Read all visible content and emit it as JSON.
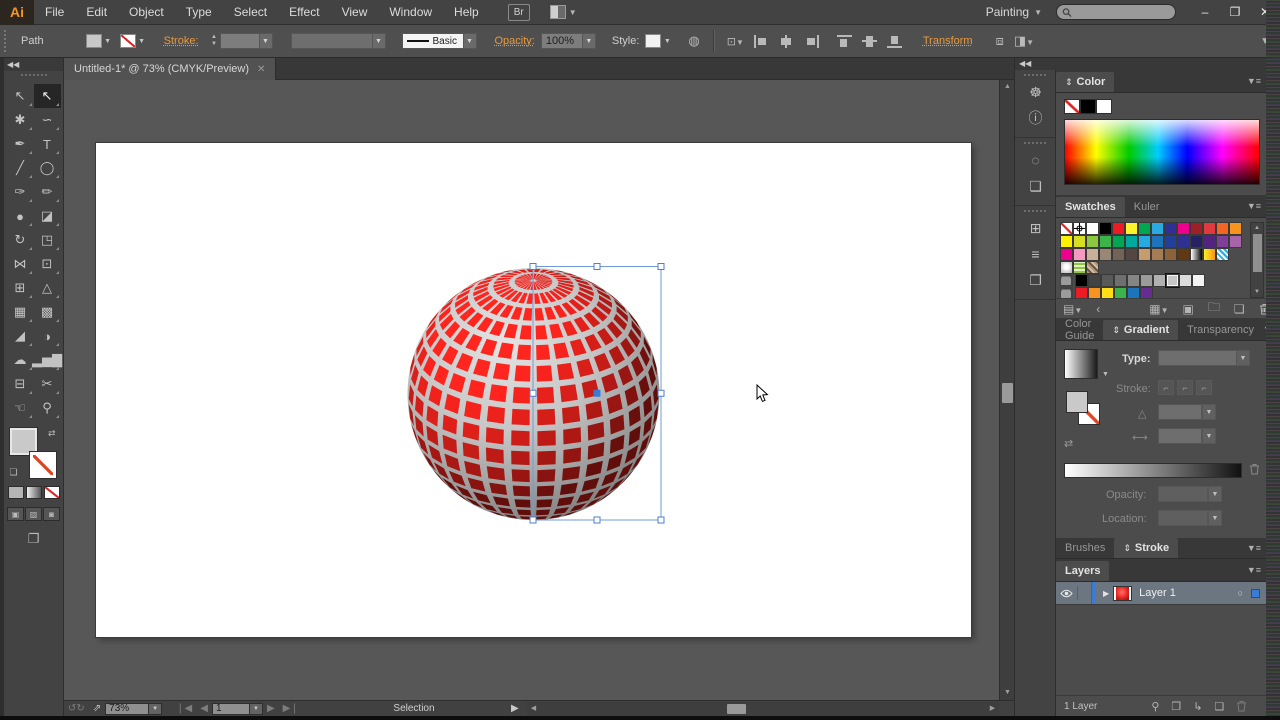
{
  "app": {
    "logo": "Ai",
    "menu_items": [
      "File",
      "Edit",
      "Object",
      "Type",
      "Select",
      "Effect",
      "View",
      "Window",
      "Help"
    ],
    "br_button": "Br",
    "workspace": "Painting",
    "search_placeholder": "",
    "window_icons": {
      "minimize": "–",
      "restore": "❐",
      "close": "✕"
    }
  },
  "control_bar": {
    "selection_type": "Path",
    "stroke_label": "Stroke:",
    "line_style": "Basic",
    "opacity_label": "Opacity:",
    "opacity_value": "100%",
    "style_label": "Style:",
    "transform_label": "Transform"
  },
  "document": {
    "tab_title": "Untitled-1* @ 73% (CMYK/Preview)",
    "close_glyph": "✕"
  },
  "status_bar": {
    "zoom_value": "73%",
    "artboard_value": "1",
    "status_text": "Selection",
    "nav_first": "❘◀",
    "nav_prev": "◀",
    "nav_next": "▶",
    "nav_last": "▶❘"
  },
  "toolbar": {
    "collapse_glyph": "◀◀",
    "tools": [
      {
        "name": "selection-tool",
        "glyph": "↖"
      },
      {
        "name": "direct-selection-tool",
        "glyph": "↖",
        "selected": true
      },
      {
        "name": "magic-wand-tool",
        "glyph": "✱"
      },
      {
        "name": "lasso-tool",
        "glyph": "∽"
      },
      {
        "name": "pen-tool",
        "glyph": "✒"
      },
      {
        "name": "type-tool",
        "glyph": "T"
      },
      {
        "name": "line-segment-tool",
        "glyph": "╱"
      },
      {
        "name": "ellipse-tool",
        "glyph": "◯"
      },
      {
        "name": "paintbrush-tool",
        "glyph": "✑"
      },
      {
        "name": "pencil-tool",
        "glyph": "✏"
      },
      {
        "name": "blob-brush-tool",
        "glyph": "●"
      },
      {
        "name": "eraser-tool",
        "glyph": "◪"
      },
      {
        "name": "rotate-tool",
        "glyph": "↻"
      },
      {
        "name": "scale-tool",
        "glyph": "◳"
      },
      {
        "name": "width-tool",
        "glyph": "⋈"
      },
      {
        "name": "free-transform-tool",
        "glyph": "⊡"
      },
      {
        "name": "shape-builder-tool",
        "glyph": "⊞"
      },
      {
        "name": "perspective-grid-tool",
        "glyph": "△"
      },
      {
        "name": "mesh-tool",
        "glyph": "▦"
      },
      {
        "name": "gradient-tool",
        "glyph": "▩"
      },
      {
        "name": "eyedropper-tool",
        "glyph": "◢"
      },
      {
        "name": "blend-tool",
        "glyph": "◑"
      },
      {
        "name": "symbol-sprayer-tool",
        "glyph": "☁"
      },
      {
        "name": "column-graph-tool",
        "glyph": "▂▅▇"
      },
      {
        "name": "artboard-tool",
        "glyph": "⊟"
      },
      {
        "name": "slice-tool",
        "glyph": "✂"
      },
      {
        "name": "hand-tool",
        "glyph": "☜"
      },
      {
        "name": "zoom-tool",
        "glyph": "⚲"
      }
    ]
  },
  "dock": {
    "collapse_glyph": "◀◀",
    "icon_sections": [
      [
        {
          "name": "navigator-icon",
          "glyph": "☸"
        },
        {
          "name": "info-icon",
          "glyph": "ⓘ"
        }
      ],
      [
        {
          "name": "attributes-icon",
          "glyph": "◌"
        },
        {
          "name": "document-info-icon",
          "glyph": "❏"
        }
      ],
      [
        {
          "name": "artboards-icon",
          "glyph": "⊞"
        },
        {
          "name": "align-icon",
          "glyph": "≡"
        },
        {
          "name": "pathfinder-icon",
          "glyph": "❐"
        }
      ]
    ]
  },
  "panels": {
    "color": {
      "title": "Color"
    },
    "swatches": {
      "tabs": [
        "Swatches",
        "Kuler"
      ],
      "rows": [
        [
          "none",
          "reg",
          "#ffffff",
          "#000000",
          "#ed1b24",
          "#fff22d",
          "#00a651",
          "#29abe2",
          "#2e3192",
          "#ec008c",
          "#9e1f28",
          "#e03a3e",
          "#f26522",
          "#f7941e"
        ],
        [
          "#fff200",
          "#d7df23",
          "#8dc63f",
          "#39b54a",
          "#00a651",
          "#00a99d",
          "#27aae1",
          "#1c75bc",
          "#21409a",
          "#2e3192",
          "#262262",
          "#52247f",
          "#7f3f98",
          "#a864a8"
        ],
        [
          "#ec008c",
          "#f49ac1",
          "#c7b299",
          "#998675",
          "#736357",
          "#534741",
          "#c69c6d",
          "#a67c52",
          "#8c6239",
          "#603913",
          "g:linear-gradient(90deg,#ffffff,#000000)",
          "g:linear-gradient(90deg,#fcee21,#f7941e)",
          "p:repeating-linear-gradient(45deg,#29abe2 0 2px,#e8f7fd 2px 4px)"
        ],
        [
          "g:radial-gradient(circle at 50% 45%,#ffffff 25%,#b3b3b3 95%)",
          "p:repeating-linear-gradient(0deg,#8dc63f 0 2px,#e3f0c8 2px 4px)",
          "p:repeating-linear-gradient(45deg,#b49a7d 0 2px,#6e5540 2px 4px,#d4c3ab 4px 6px)"
        ],
        [
          "folder",
          "#000000",
          "#434343",
          "#595959",
          "#6f6f6f",
          "#858585",
          "#9b9b9b",
          "#b1b1b1",
          "sel:#c7c7c7",
          "#dddddd",
          "#f3f3f3"
        ],
        [
          "folder",
          "#ed1c24",
          "#f7941e",
          "#ffde17",
          "#39b54a",
          "#1c75bc",
          "#662d91"
        ]
      ]
    },
    "gradient": {
      "tabs": [
        "Color Guide",
        "Gradient",
        "Transparency"
      ],
      "active_tab": "Gradient",
      "type_label": "Type:",
      "stroke_label": "Stroke:",
      "opacity_label": "Opacity:",
      "location_label": "Location:"
    },
    "stroke_group": {
      "tabs": [
        "Brushes",
        "Stroke"
      ],
      "active_tab": "Stroke"
    },
    "layers": {
      "title": "Layers",
      "layer_name": "Layer 1",
      "count_label": "1 Layer"
    }
  },
  "artwork": {
    "cell_color_rgb": [
      240,
      34,
      28
    ],
    "base_gradient": [
      "#e4e4e4",
      "#c6c6c6",
      "#9d9d9d",
      "#787878"
    ],
    "selection_color": "#6f9bd8",
    "handle_fill": "#ffffff",
    "handle_stroke": "#4f7fd0",
    "center_fill": "#3a7bd5"
  }
}
